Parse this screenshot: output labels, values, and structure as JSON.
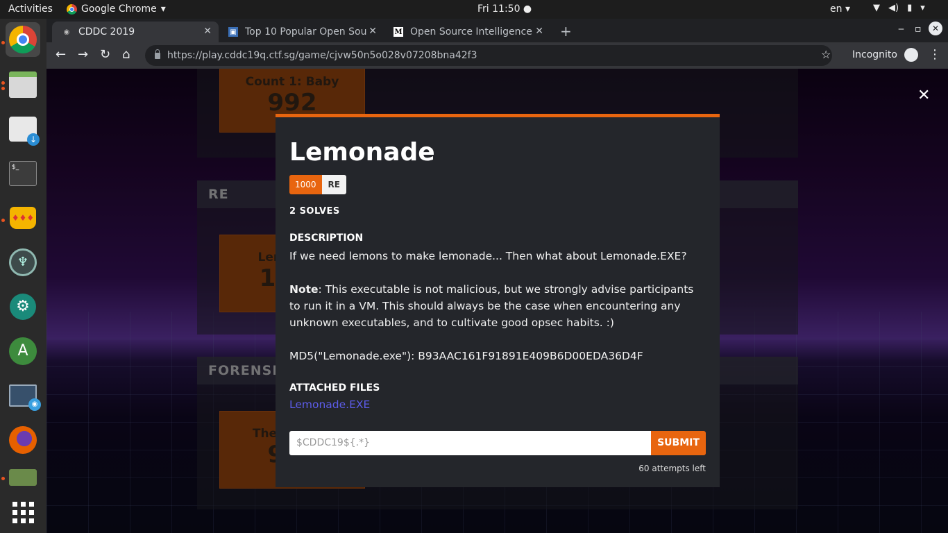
{
  "system": {
    "activities": "Activities",
    "app_name": "Google Chrome",
    "clock": "Fri 11:50",
    "language": "en"
  },
  "browser": {
    "tabs": [
      {
        "title": "CDDC 2019",
        "active": true
      },
      {
        "title": "Top 10 Popular Open Sou",
        "active": false
      },
      {
        "title": "Open Source Intelligence",
        "active": false
      }
    ],
    "url": "https://play.cddc19q.ctf.sg/game/cjvw50n5o028v07208bna42f3",
    "incognito_label": "Incognito"
  },
  "background": {
    "sections": [
      {
        "name": "",
        "card_name": "Count 1: Baby",
        "card_points": "992"
      },
      {
        "name": "RE",
        "card_name": "Lemonade",
        "card_points": "1000"
      },
      {
        "name": "FORENSICS",
        "card_name": "The Terrible",
        "card_points": "984"
      }
    ]
  },
  "modal": {
    "title": "Lemonade",
    "points": "1000",
    "category": "RE",
    "solves": "2 SOLVES",
    "description_label": "DESCRIPTION",
    "description_line1": "If we need lemons to make lemonade... Then what about Lemonade.EXE?",
    "note_label": "Note",
    "note_text": ": This executable is not malicious, but we strongly advise participants to run it in a VM. This should always be the case when encountering any unknown executables, and to cultivate good opsec habits. :)",
    "md5": "MD5(\"Lemonade.exe\"): B93AAC161F91891E409B6D00EDA36D4F",
    "attached_label": "ATTACHED FILES",
    "file_name": "Lemonade.EXE",
    "flag_placeholder": "$CDDC19${.*}",
    "submit_label": "SUBMIT",
    "attempts": "60 attempts left"
  },
  "colors": {
    "accent": "#e8650f",
    "link": "#5c5ce8",
    "modal_bg": "#24262b"
  }
}
